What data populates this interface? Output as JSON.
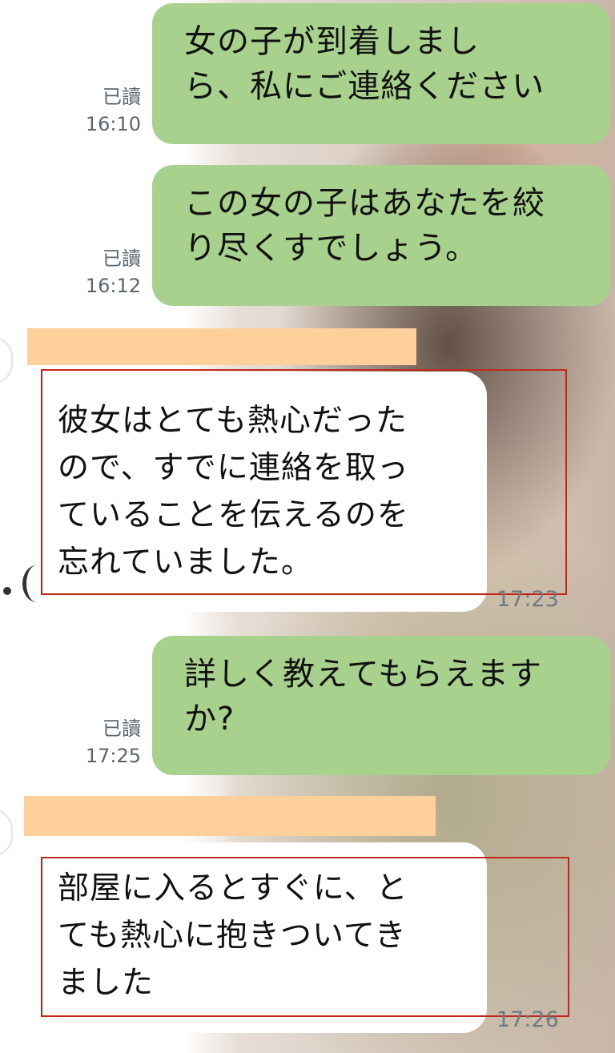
{
  "messages": [
    {
      "id": "m1",
      "read_label": "已讀",
      "time": "16:10",
      "lines": [
        "女の子が到着しまし",
        "ら、私にご連絡ください"
      ]
    },
    {
      "id": "m2",
      "read_label": "已讀",
      "time": "16:12",
      "lines": [
        "この女の子はあなたを絞",
        "り尽くすでしょう。"
      ]
    },
    {
      "id": "m3",
      "time": "17:23",
      "lines": [
        "彼女はとても熱心だった",
        "ので、すでに連絡を取っ",
        "ていることを伝えるのを",
        "忘れていました。"
      ]
    },
    {
      "id": "m4",
      "read_label": "已讀",
      "time": "17:25",
      "lines": [
        "詳しく教えてもらえます",
        "か?"
      ]
    },
    {
      "id": "m5",
      "time": "17:26",
      "lines": [
        "部屋に入るとすぐに、と",
        "ても熱心に抱きついてき",
        "ました"
      ]
    }
  ],
  "colors": {
    "outgoing_bubble": "#a9d18e",
    "incoming_bubble": "#ffffff",
    "name_redaction": "#ffd09b",
    "highlight_box": "#c0281e"
  }
}
